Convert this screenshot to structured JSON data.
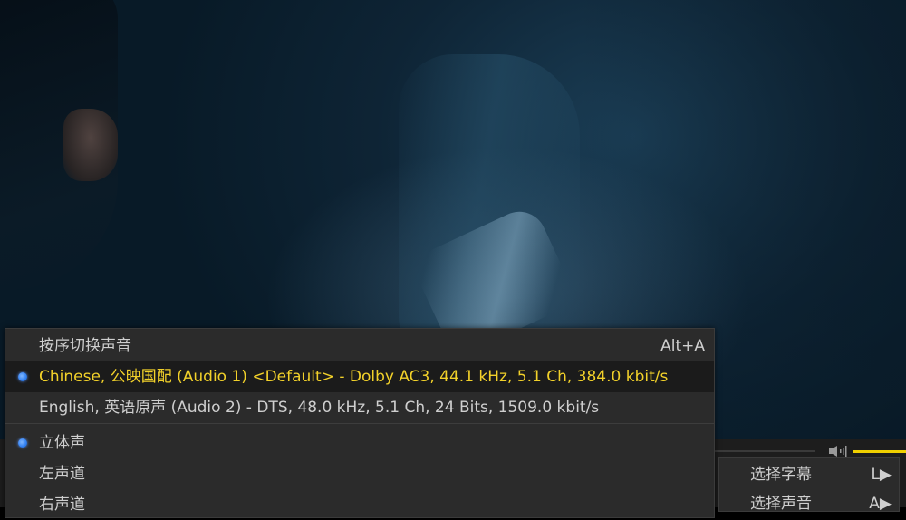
{
  "audio_menu": {
    "cycle_item": {
      "label": "按序切换声音",
      "shortcut": "Alt+A"
    },
    "tracks": [
      {
        "label": "Chinese, 公映国配 (Audio 1) <Default> - Dolby AC3, 44.1 kHz, 5.1 Ch, 384.0 kbit/s",
        "selected": true
      },
      {
        "label": "English, 英语原声 (Audio 2) - DTS, 48.0 kHz, 5.1 Ch, 24 Bits, 1509.0 kbit/s",
        "selected": false
      }
    ],
    "channel_modes": [
      {
        "label": "立体声",
        "selected": true
      },
      {
        "label": "左声道",
        "selected": false
      },
      {
        "label": "右声道",
        "selected": false
      }
    ]
  },
  "main_menu": {
    "items": [
      {
        "label": "选择字幕",
        "shortcut": "L▶"
      },
      {
        "label": "选择声音",
        "shortcut": "A▶"
      }
    ]
  },
  "player": {
    "accent_color": "#f2d12a",
    "radio_color": "#2f7ff2",
    "volume_color": "#f0d000"
  }
}
